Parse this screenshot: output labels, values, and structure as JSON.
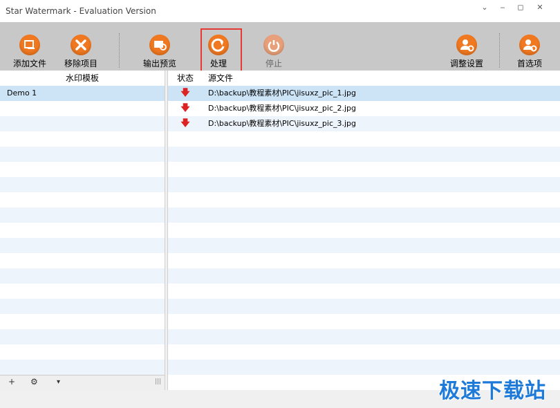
{
  "window": {
    "title": "Star Watermark - Evaluation Version"
  },
  "toolbar": {
    "buttons": [
      {
        "label": "添加文件",
        "icon": "add-file-icon"
      },
      {
        "label": "移除项目",
        "icon": "remove-icon"
      },
      {
        "label": "输出预览",
        "icon": "preview-icon"
      },
      {
        "label": "处理",
        "icon": "process-icon"
      },
      {
        "label": "停止",
        "icon": "stop-icon"
      },
      {
        "label": "调整设置",
        "icon": "adjust-settings-icon"
      },
      {
        "label": "首选项",
        "icon": "preferences-icon"
      }
    ]
  },
  "left_panel": {
    "header": "水印模板",
    "items": [
      "Demo 1"
    ]
  },
  "right_panel": {
    "columns": [
      "状态",
      "源文件"
    ],
    "files": [
      "D:\\backup\\教程素材\\PIC\\jisuxz_pic_1.jpg",
      "D:\\backup\\教程素材\\PIC\\jisuxz_pic_2.jpg",
      "D:\\backup\\教程素材\\PIC\\jisuxz_pic_3.jpg"
    ],
    "status_glyph": "🡇"
  },
  "footer": {
    "add": "+",
    "gear": "⚙",
    "dropdown": "▾",
    "grip": "|||"
  },
  "watermark": "极速下载站",
  "colors": {
    "accent_orange": "#f07820",
    "highlight": "#e53935",
    "watermark": "#1e7ad8"
  }
}
